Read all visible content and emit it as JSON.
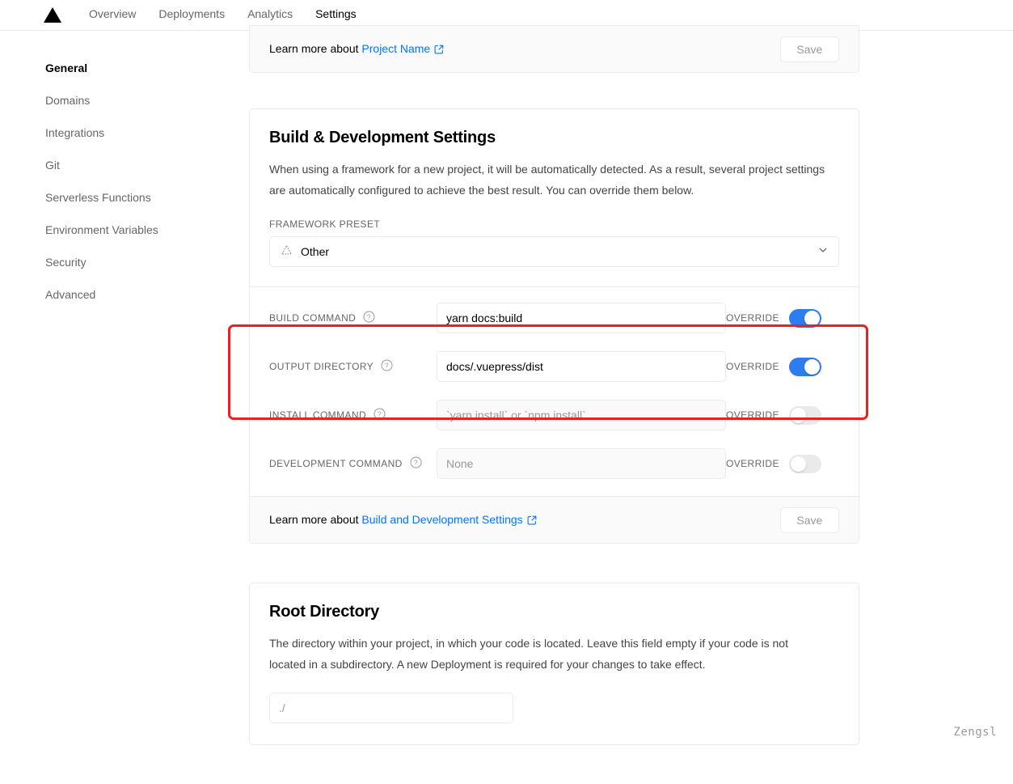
{
  "topnav": {
    "logo": "vercel-triangle-logo",
    "items": [
      {
        "label": "Overview",
        "active": false
      },
      {
        "label": "Deployments",
        "active": false
      },
      {
        "label": "Analytics",
        "active": false
      },
      {
        "label": "Settings",
        "active": true
      }
    ]
  },
  "sidebar": {
    "items": [
      {
        "label": "General",
        "active": true
      },
      {
        "label": "Domains",
        "active": false
      },
      {
        "label": "Integrations",
        "active": false
      },
      {
        "label": "Git",
        "active": false
      },
      {
        "label": "Serverless Functions",
        "active": false
      },
      {
        "label": "Environment Variables",
        "active": false
      },
      {
        "label": "Security",
        "active": false
      },
      {
        "label": "Advanced",
        "active": false
      }
    ]
  },
  "project_name_card": {
    "footer_prefix": "Learn more about ",
    "footer_link": "Project Name",
    "save_label": "Save"
  },
  "build_card": {
    "title": "Build & Development Settings",
    "description": "When using a framework for a new project, it will be automatically detected. As a result, several project settings are automatically configured to achieve the best result. You can override them below.",
    "framework_preset_label": "Framework Preset",
    "framework_preset_value": "Other",
    "framework_preset_icon": "dotted-triangle-icon",
    "rows": [
      {
        "label": "Build Command",
        "value": "yarn docs:build",
        "placeholder": "",
        "override_label": "Override",
        "override_on": true,
        "disabled": false
      },
      {
        "label": "Output Directory",
        "value": "docs/.vuepress/dist",
        "placeholder": "",
        "override_label": "Override",
        "override_on": true,
        "disabled": false
      },
      {
        "label": "Install Command",
        "value": "",
        "placeholder": "`yarn install` or `npm install`",
        "override_label": "Override",
        "override_on": false,
        "disabled": true
      },
      {
        "label": "Development Command",
        "value": "",
        "placeholder": "None",
        "override_label": "Override",
        "override_on": false,
        "disabled": true
      }
    ],
    "footer_prefix": "Learn more about ",
    "footer_link": "Build and Development Settings",
    "save_label": "Save"
  },
  "root_card": {
    "title": "Root Directory",
    "description": "The directory within your project, in which your code is located. Leave this field empty if your code is not located in a subdirectory. A new Deployment is required for your changes to take effect.",
    "input_placeholder": "./",
    "input_value": ""
  },
  "annotation": {
    "color": "#f01f1f",
    "note": "highlight around Build Command and Output Directory rows"
  },
  "watermark": {
    "text": "Zengsl"
  },
  "colors": {
    "accent_blue": "#0076ff",
    "toggle_on": "#2e7df0",
    "toggle_off": "#eaeaea",
    "border": "#eaeaea",
    "muted_text": "#666666",
    "footer_bg": "#fafafa"
  }
}
